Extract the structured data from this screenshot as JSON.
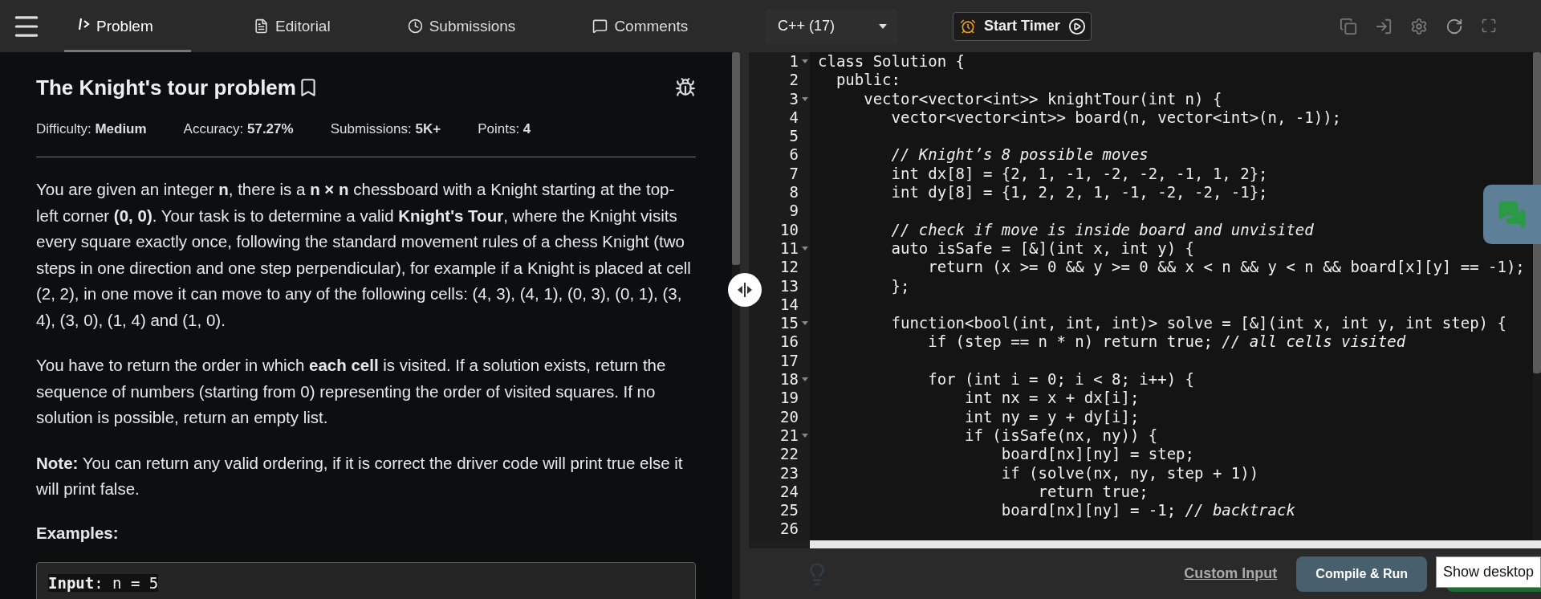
{
  "tabs": [
    {
      "label": "Problem",
      "selected": true
    },
    {
      "label": "Editorial",
      "selected": false
    },
    {
      "label": "Submissions",
      "selected": false
    },
    {
      "label": "Comments",
      "selected": false
    }
  ],
  "problem": {
    "title": "The Knight's tour problem",
    "stats": [
      {
        "label": "Difficulty: ",
        "value": "Medium"
      },
      {
        "label": "Accuracy: ",
        "value": "57.27%"
      },
      {
        "label": "Submissions: ",
        "value": "5K+"
      },
      {
        "label": "Points: ",
        "value": "4"
      }
    ],
    "paragraphs": [
      "You are given an integer **n**, there is a **n × n** chessboard with a Knight starting at the top-left corner **(0, 0)**. Your task is to determine a valid **Knight's Tour**, where the Knight visits every square exactly once, following the standard movement rules of a chess Knight (two steps in one direction and one step perpendicular), for example if a Knight is placed at cell (2, 2), in one move it can move to any of the following cells: (4, 3), (4, 1), (0, 3), (0, 1), (3, 4), (3, 0), (1, 4) and (1, 0).",
      "You have to return the order in which **each cell** is visited. If a solution exists, return the sequence of numbers (starting from 0) representing the order of visited squares. If no solution is possible, return an empty list.",
      "**Note:** You can return any valid ordering, if it is correct the driver code will print true else it will print false."
    ],
    "examples_heading": "Examples:",
    "example_input": "**Input**: n = 5"
  },
  "editor": {
    "language": "C++ (17)",
    "timer": "Start Timer",
    "lines": [
      {
        "n": "1",
        "code": "class Solution {",
        "fold": true
      },
      {
        "n": "2",
        "code": "  public:",
        "fold": false
      },
      {
        "n": "3",
        "code": "     vector<vector<int>> knightTour(int n) {",
        "fold": true
      },
      {
        "n": "4",
        "code": "        vector<vector<int>> board(n, vector<int>(n, -1));",
        "fold": false
      },
      {
        "n": "5",
        "fold": false
      },
      {
        "n": "6",
        "comment": "        // Knight’s 8 possible moves",
        "fold": false
      },
      {
        "n": "7",
        "code": "        int dx[8] = {2, 1, -1, -2, -2, -1, 1, 2};",
        "fold": false
      },
      {
        "n": "8",
        "code": "        int dy[8] = {1, 2, 2, 1, -1, -2, -2, -1};",
        "fold": false
      },
      {
        "n": "9",
        "fold": false
      },
      {
        "n": "10",
        "comment": "        // check if move is inside board and unvisited",
        "fold": false
      },
      {
        "n": "11",
        "code": "        auto isSafe = [&](int x, int y) {",
        "fold": true
      },
      {
        "n": "12",
        "code": "            return (x >= 0 && y >= 0 && x < n && y < n && board[x][y] == -1);",
        "fold": false
      },
      {
        "n": "13",
        "code": "        };",
        "fold": false
      },
      {
        "n": "14",
        "fold": false
      },
      {
        "n": "15",
        "code": "        function<bool(int, int, int)> solve = [&](int x, int y, int step) {",
        "fold": true
      },
      {
        "n": "16",
        "code": "            if (step == n * n) return true; ",
        "comment": "// all cells visited",
        "fold": false
      },
      {
        "n": "17",
        "fold": false
      },
      {
        "n": "18",
        "code": "            for (int i = 0; i < 8; i++) {",
        "fold": true
      },
      {
        "n": "19",
        "code": "                int nx = x + dx[i];",
        "fold": false
      },
      {
        "n": "20",
        "code": "                int ny = y + dy[i];",
        "fold": false
      },
      {
        "n": "21",
        "code": "                if (isSafe(nx, ny)) {",
        "fold": true
      },
      {
        "n": "22",
        "code": "                    board[nx][ny] = step;",
        "fold": false
      },
      {
        "n": "23",
        "code": "                    if (solve(nx, ny, step + 1))",
        "fold": false
      },
      {
        "n": "24",
        "code": "                        return true;",
        "fold": false
      },
      {
        "n": "25",
        "code": "                    board[nx][ny] = -1; ",
        "comment": "// backtrack",
        "fold": false
      },
      {
        "n": "26",
        "fold": false
      }
    ]
  },
  "footer": {
    "custom_input": "Custom Input",
    "compile": "Compile & Run",
    "tooltip": "Show desktop"
  }
}
